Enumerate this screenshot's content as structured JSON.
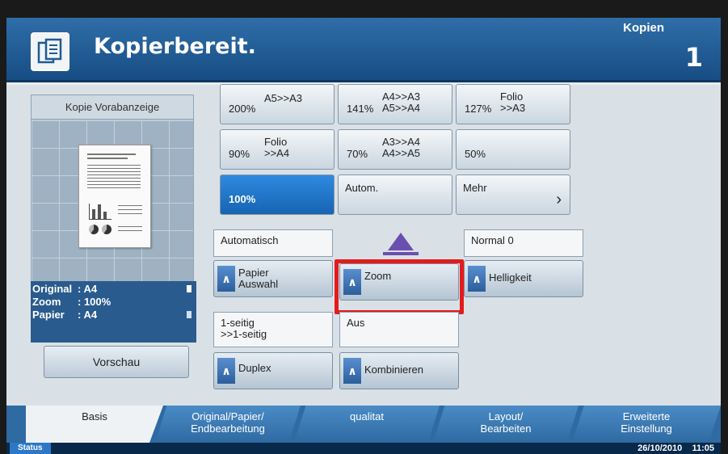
{
  "header": {
    "title": "Kopierbereit.",
    "copies_label": "Kopien",
    "copies_value": "1"
  },
  "preview": {
    "heading": "Kopie Vorabanzeige",
    "button_label": "Vorschau",
    "info": [
      {
        "key": "Original",
        "value": ": A4"
      },
      {
        "key": "Zoom",
        "value": ": 100%"
      },
      {
        "key": "Papier",
        "value": ": A4"
      }
    ]
  },
  "zoom_buttons": [
    {
      "pct": "200%",
      "desc": "A5>>A3"
    },
    {
      "pct": "141%",
      "desc": "A4>>A3\nA5>>A4"
    },
    {
      "pct": "127%",
      "desc": "Folio\n>>A3"
    },
    {
      "pct": "90%",
      "desc": "Folio\n>>A4"
    },
    {
      "pct": "70%",
      "desc": "A3>>A4\nA4>>A5"
    },
    {
      "pct": "50%",
      "desc": ""
    },
    {
      "pct": "100%",
      "desc": "",
      "selected": true
    },
    {
      "pct": "Autom.",
      "desc": ""
    },
    {
      "pct": "Mehr",
      "desc": ""
    }
  ],
  "settings": {
    "paper_value": "Automatisch",
    "paper_label": "Papier\nAuswahl",
    "zoom_label": "Zoom",
    "brightness_value": "Normal 0",
    "brightness_label": "Helligkeit",
    "duplex_value": "1-seitig\n>>1-seitig",
    "duplex_label": "Duplex",
    "combine_value": "Aus",
    "combine_label": "Kombinieren"
  },
  "tabs": [
    {
      "label": "Basis"
    },
    {
      "label": "Original/Papier/\nEndbearbeitung"
    },
    {
      "label": "qualitat"
    },
    {
      "label": "Layout/\nBearbeiten"
    },
    {
      "label": "Erweiterte\nEinstellung"
    }
  ],
  "status": {
    "button": "Status",
    "date": "26/10/2010",
    "time": "11:05"
  },
  "colors": {
    "header_blue": "#1f5b94",
    "selected_blue": "#1f74c7",
    "highlight_red": "#e31b1b"
  }
}
